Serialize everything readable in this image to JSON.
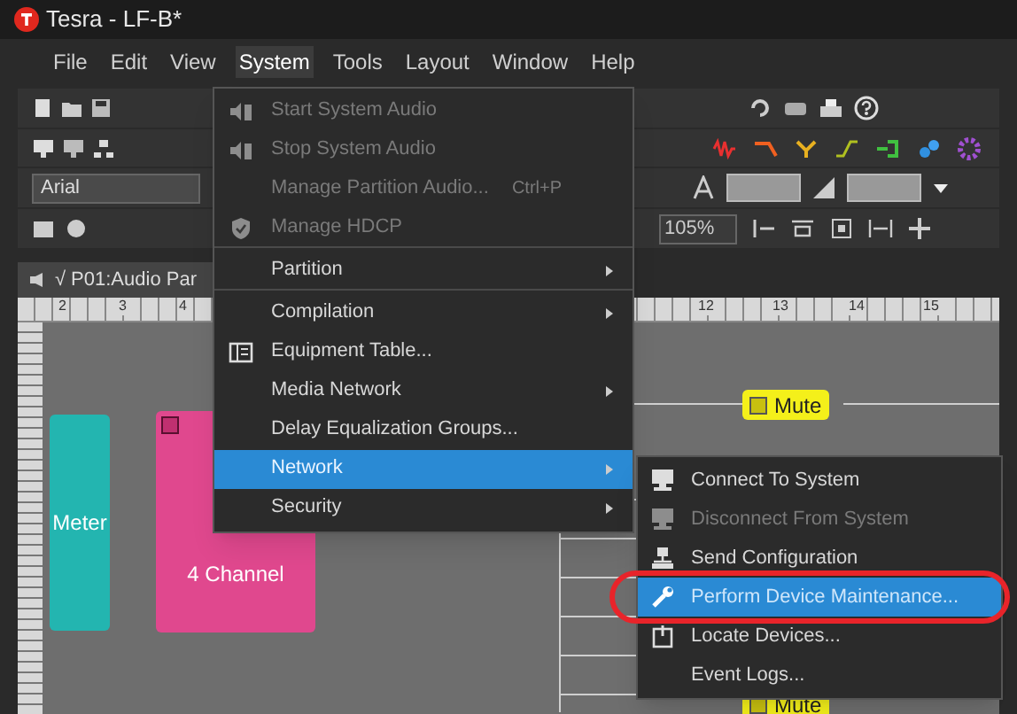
{
  "window": {
    "title": "Tesra - LF-B*"
  },
  "menu_bar": [
    {
      "label": "File",
      "selected": false
    },
    {
      "label": "Edit",
      "selected": false
    },
    {
      "label": "View",
      "selected": false
    },
    {
      "label": "System",
      "selected": true
    },
    {
      "label": "Tools",
      "selected": false
    },
    {
      "label": "Layout",
      "selected": false
    },
    {
      "label": "Window",
      "selected": false
    },
    {
      "label": "Help",
      "selected": false
    }
  ],
  "toolbar": {
    "font": "Arial",
    "zoom": "105%"
  },
  "document_tab": {
    "check": "√",
    "label": "P01:Audio Par"
  },
  "ruler": {
    "ticks": [
      "2",
      "3",
      "4",
      "12",
      "13",
      "14",
      "15"
    ]
  },
  "canvas": {
    "blocks": [
      {
        "kind": "meter",
        "label": "Meter"
      },
      {
        "kind": "channel",
        "label": "4 Channel"
      }
    ],
    "mute_blocks": [
      {
        "label": "Mute"
      },
      {
        "label": "Mute"
      }
    ]
  },
  "system_menu": [
    {
      "label": "Start System Audio",
      "kind": "speaker",
      "disabled": true,
      "submenu": false,
      "selected": false,
      "separator_after": false
    },
    {
      "label": "Stop System Audio",
      "kind": "speaker",
      "disabled": true,
      "submenu": false,
      "selected": false,
      "separator_after": false
    },
    {
      "label": "Manage Partition Audio...",
      "shortcut": "Ctrl+P",
      "disabled": true,
      "submenu": false,
      "selected": false,
      "separator_after": false
    },
    {
      "label": "Manage HDCP",
      "kind": "shield",
      "disabled": true,
      "submenu": false,
      "selected": false,
      "separator_after": true
    },
    {
      "label": "Partition",
      "disabled": false,
      "submenu": true,
      "selected": false,
      "separator_after": true
    },
    {
      "label": "Compilation",
      "disabled": false,
      "submenu": true,
      "selected": false,
      "separator_after": false
    },
    {
      "label": "Equipment Table...",
      "kind": "table",
      "disabled": false,
      "submenu": false,
      "selected": false,
      "separator_after": false
    },
    {
      "label": "Media Network",
      "disabled": false,
      "submenu": true,
      "selected": false,
      "separator_after": false
    },
    {
      "label": "Delay Equalization Groups...",
      "disabled": false,
      "submenu": false,
      "selected": false,
      "separator_after": false
    },
    {
      "label": "Network",
      "disabled": false,
      "submenu": true,
      "selected": true,
      "separator_after": false
    },
    {
      "label": "Security",
      "disabled": false,
      "submenu": true,
      "selected": false,
      "separator_after": false
    }
  ],
  "network_submenu": [
    {
      "label": "Connect To System",
      "kind": "monitor",
      "disabled": false,
      "selected": false
    },
    {
      "label": "Disconnect From System",
      "kind": "monitor",
      "disabled": true,
      "selected": false
    },
    {
      "label": "Send Configuration",
      "kind": "network",
      "disabled": false,
      "selected": false
    },
    {
      "label": "Perform Device Maintenance...",
      "kind": "wrench",
      "disabled": false,
      "selected": true,
      "highlighted": true
    },
    {
      "label": "Locate Devices...",
      "kind": "device",
      "disabled": false,
      "selected": false
    },
    {
      "label": "Event Logs...",
      "disabled": false,
      "selected": false
    }
  ]
}
